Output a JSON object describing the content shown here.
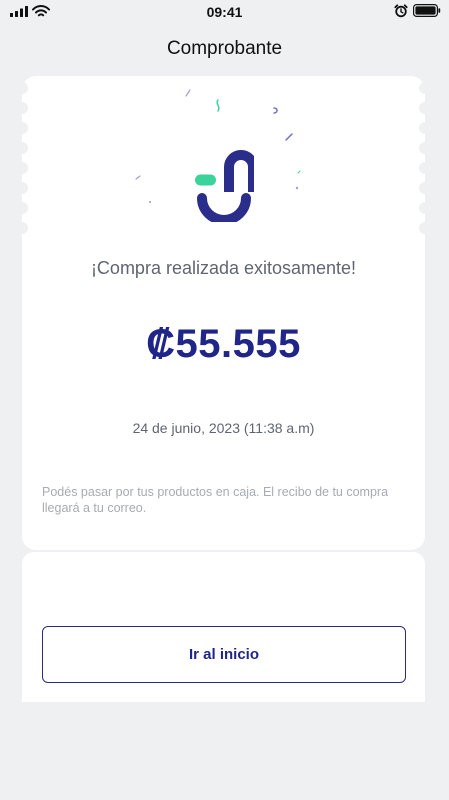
{
  "status_bar": {
    "time": "09:41"
  },
  "header": {
    "title": "Comprobante"
  },
  "receipt": {
    "success_message": "¡Compra realizada exitosamente!",
    "amount": "₡55.555",
    "date": "24 de junio, 2023 (11:38 a.m)",
    "info": "Podés pasar por tus productos en caja. El recibo de tu compra llegará a tu correo."
  },
  "actions": {
    "home_label": "Ir al inicio"
  },
  "colors": {
    "brand_blue": "#202689",
    "brand_green": "#3ad39a",
    "background": "#eff0f2",
    "card": "#ffffff"
  },
  "icons": [
    "signal-icon",
    "wifi-icon",
    "alarm-icon",
    "battery-icon",
    "brand-logo-icon",
    "confetti-decoration"
  ]
}
